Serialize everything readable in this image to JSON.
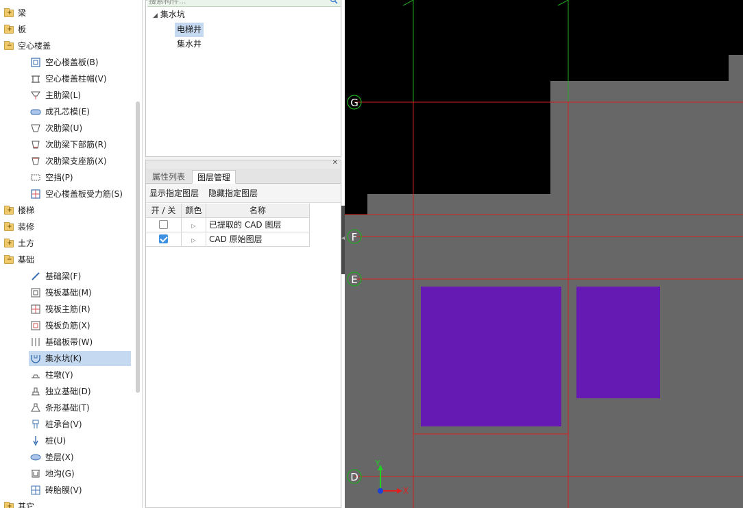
{
  "tree": {
    "items": [
      {
        "type": "folder",
        "label": "梁",
        "state": "+"
      },
      {
        "type": "folder",
        "label": "板",
        "state": "+"
      },
      {
        "type": "folder",
        "label": "空心楼盖",
        "state": "-"
      },
      {
        "type": "child",
        "label": "空心楼盖板(B)",
        "icon": "hollow-slab-icon"
      },
      {
        "type": "child",
        "label": "空心楼盖柱帽(V)",
        "icon": "column-cap-icon"
      },
      {
        "type": "child",
        "label": "主肋梁(L)",
        "icon": "main-rib-beam-icon"
      },
      {
        "type": "child",
        "label": "成孔芯模(E)",
        "icon": "core-mold-icon"
      },
      {
        "type": "child",
        "label": "次肋梁(U)",
        "icon": "secondary-rib-beam-icon"
      },
      {
        "type": "child",
        "label": "次肋梁下部筋(R)",
        "icon": "rib-bottom-rebar-icon"
      },
      {
        "type": "child",
        "label": "次肋梁支座筋(X)",
        "icon": "rib-support-rebar-icon"
      },
      {
        "type": "child",
        "label": "空挡(P)",
        "icon": "void-icon"
      },
      {
        "type": "child",
        "label": "空心楼盖板受力筋(S)",
        "icon": "slab-stress-rebar-icon"
      },
      {
        "type": "folder",
        "label": "楼梯",
        "state": "+"
      },
      {
        "type": "folder",
        "label": "装修",
        "state": "+"
      },
      {
        "type": "folder",
        "label": "土方",
        "state": "+"
      },
      {
        "type": "folder",
        "label": "基础",
        "state": "-"
      },
      {
        "type": "child",
        "label": "基础梁(F)",
        "icon": "foundation-beam-icon"
      },
      {
        "type": "child",
        "label": "筏板基础(M)",
        "icon": "raft-foundation-icon"
      },
      {
        "type": "child",
        "label": "筏板主筋(R)",
        "icon": "raft-main-rebar-icon"
      },
      {
        "type": "child",
        "label": "筏板负筋(X)",
        "icon": "raft-negative-rebar-icon"
      },
      {
        "type": "child",
        "label": "基础板带(W)",
        "icon": "foundation-strip-icon"
      },
      {
        "type": "child",
        "label": "集水坑(K)",
        "icon": "sump-pit-icon",
        "selected": true
      },
      {
        "type": "child",
        "label": "柱墩(Y)",
        "icon": "column-pier-icon"
      },
      {
        "type": "child",
        "label": "独立基础(D)",
        "icon": "isolated-footing-icon"
      },
      {
        "type": "child",
        "label": "条形基础(T)",
        "icon": "strip-footing-icon"
      },
      {
        "type": "child",
        "label": "桩承台(V)",
        "icon": "pile-cap-icon"
      },
      {
        "type": "child",
        "label": "桩(U)",
        "icon": "pile-icon"
      },
      {
        "type": "child",
        "label": "垫层(X)",
        "icon": "cushion-icon"
      },
      {
        "type": "child",
        "label": "地沟(G)",
        "icon": "trench-icon"
      },
      {
        "type": "child",
        "label": "砖胎膜(V)",
        "icon": "brick-mold-icon"
      },
      {
        "type": "folder",
        "label": "其它",
        "state": "+"
      }
    ]
  },
  "components": {
    "search_placeholder": "搜索构件...",
    "root": "集水坑",
    "items": [
      "电梯井",
      "集水井"
    ]
  },
  "props_panel": {
    "tabs": [
      "属性列表",
      "图层管理"
    ],
    "active_tab": "图层管理",
    "toolbar": {
      "show": "显示指定图层",
      "hide": "隐藏指定图层"
    },
    "headers": {
      "onoff": "开 / 关",
      "color": "颜色",
      "name": "名称"
    },
    "rows": [
      {
        "checked": false,
        "name": "已提取的 CAD 图层"
      },
      {
        "checked": true,
        "name": "CAD 原始图层"
      }
    ]
  },
  "cad": {
    "axis_labels": {
      "G": "G",
      "F": "F",
      "E": "E",
      "D": "D"
    },
    "ucs": {
      "x": "X",
      "y": "Y"
    },
    "colors": {
      "background": "#000000",
      "slab": "#676767",
      "grid": "#d42020",
      "green": "#1faa1f",
      "pit": "#651ab3"
    }
  }
}
